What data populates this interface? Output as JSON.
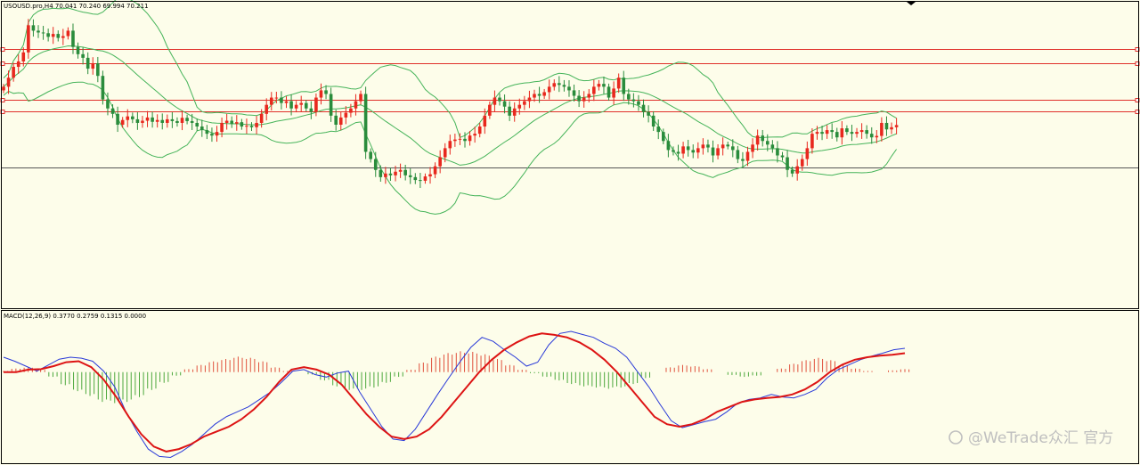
{
  "header": {
    "price_label": "USOUSD.pro,H4  70.041 70.240 69.994 70.211",
    "macd_label": "MACD(12,26,9) 0.3770 0.2759 0.1315 0.0000"
  },
  "watermark": "@WeTrade众汇 官方",
  "colors": {
    "background": "#fdfdea",
    "bull_candle": "#e8281e",
    "bear_candle": "#2a8c3c",
    "bollinger": "#46b45a",
    "level_line": "#e0302a",
    "current_price_line": "#555555",
    "macd_line": "#2a3ad8",
    "signal_line": "#dd1414",
    "hist_positive": "#e0503c",
    "hist_negative": "#4ca83c"
  },
  "chart_data": [
    {
      "type": "candlestick",
      "symbol": "USOUSD.pro",
      "timeframe": "H4",
      "last_bar": {
        "open": 70.041,
        "high": 70.24,
        "low": 69.994,
        "close": 70.211
      },
      "ylim": [
        66.2,
        74.6
      ],
      "closes": [
        72.3,
        72.55,
        72.85,
        73.0,
        73.25,
        74.0,
        73.85,
        73.8,
        73.78,
        73.68,
        73.76,
        73.65,
        73.7,
        73.85,
        73.4,
        73.2,
        73.1,
        72.8,
        72.95,
        72.6,
        71.95,
        71.7,
        71.55,
        71.25,
        71.38,
        71.48,
        71.4,
        71.3,
        71.36,
        71.45,
        71.33,
        71.38,
        71.3,
        71.4,
        71.35,
        71.3,
        71.44,
        71.35,
        71.3,
        71.2,
        71.1,
        71.0,
        70.95,
        71.05,
        71.3,
        71.36,
        71.28,
        71.32,
        71.2,
        71.22,
        71.18,
        71.3,
        71.55,
        71.8,
        72.0,
        72.0,
        71.85,
        71.9,
        71.7,
        71.8,
        71.85,
        71.7,
        71.6,
        72.0,
        72.2,
        72.1,
        71.5,
        71.25,
        71.45,
        71.58,
        71.7,
        71.9,
        72.1,
        70.5,
        70.3,
        70.0,
        69.8,
        69.9,
        69.85,
        69.95,
        70.0,
        69.85,
        69.8,
        69.72,
        69.7,
        69.82,
        69.88,
        70.1,
        70.35,
        70.6,
        70.8,
        70.84,
        70.86,
        70.8,
        70.95,
        71.0,
        71.2,
        71.5,
        71.8,
        72.0,
        71.9,
        71.75,
        71.5,
        71.7,
        71.8,
        71.9,
        72.0,
        72.1,
        72.05,
        72.15,
        72.3,
        72.4,
        72.35,
        72.3,
        72.2,
        72.05,
        71.9,
        72.0,
        72.1,
        72.3,
        72.38,
        72.3,
        72.0,
        72.25,
        72.55,
        72.1,
        71.95,
        71.9,
        71.8,
        71.6,
        71.5,
        71.2,
        71.05,
        70.8,
        70.55,
        70.5,
        70.45,
        70.65,
        70.55,
        70.48,
        70.6,
        70.7,
        70.62,
        70.4,
        70.6,
        70.7,
        70.65,
        70.55,
        70.3,
        70.25,
        70.5,
        70.7,
        70.95,
        70.8,
        70.7,
        70.6,
        70.4,
        70.35,
        70.0,
        69.9,
        70.1,
        70.3,
        70.6,
        71.0,
        71.05,
        71.0,
        71.1,
        71.05,
        70.9,
        71.15,
        71.05,
        71.0,
        71.05,
        71.1,
        71.0,
        70.9,
        70.94,
        71.3,
        71.12,
        71.18,
        71.24
      ]
    },
    {
      "type": "line",
      "indicator": "MACD(12,26,9)",
      "series": [
        {
          "name": "MACD",
          "values": [
            0.3,
            0.22,
            0.12,
            0.02,
            0.14,
            0.26,
            0.3,
            0.28,
            0.22,
            0.02,
            -0.3,
            -0.8,
            -1.2,
            -1.55,
            -1.7,
            -1.72,
            -1.6,
            -1.45,
            -1.25,
            -1.05,
            -0.9,
            -0.8,
            -0.7,
            -0.55,
            -0.4,
            -0.2,
            0.02,
            0.05,
            -0.05,
            -0.1,
            -0.02,
            0.02,
            -0.4,
            -0.75,
            -1.1,
            -1.35,
            -1.38,
            -1.15,
            -0.8,
            -0.45,
            -0.12,
            0.2,
            0.5,
            0.7,
            0.62,
            0.45,
            0.3,
            0.12,
            0.2,
            0.55,
            0.78,
            0.82,
            0.76,
            0.7,
            0.58,
            0.48,
            0.3,
            0.0,
            -0.3,
            -0.65,
            -0.98,
            -1.12,
            -1.06,
            -1.0,
            -0.95,
            -0.8,
            -0.62,
            -0.55,
            -0.52,
            -0.45,
            -0.5,
            -0.52,
            -0.45,
            -0.35,
            -0.12,
            0.05,
            0.15,
            0.25,
            0.32,
            0.38,
            0.45,
            0.48
          ]
        },
        {
          "name": "Signal",
          "values": [
            0.0,
            0.0,
            0.05,
            0.06,
            0.12,
            0.2,
            0.22,
            0.1,
            -0.15,
            -0.5,
            -0.9,
            -1.25,
            -1.5,
            -1.6,
            -1.55,
            -1.45,
            -1.3,
            -1.2,
            -1.1,
            -0.95,
            -0.75,
            -0.5,
            -0.2,
            0.05,
            0.1,
            0.05,
            -0.05,
            -0.25,
            -0.55,
            -0.85,
            -1.1,
            -1.3,
            -1.35,
            -1.3,
            -1.15,
            -0.9,
            -0.6,
            -0.3,
            0.0,
            0.25,
            0.45,
            0.6,
            0.72,
            0.78,
            0.75,
            0.7,
            0.6,
            0.45,
            0.25,
            0.0,
            -0.3,
            -0.6,
            -0.9,
            -1.05,
            -1.1,
            -1.05,
            -0.95,
            -0.8,
            -0.7,
            -0.6,
            -0.55,
            -0.52,
            -0.5,
            -0.45,
            -0.35,
            -0.2,
            0.0,
            0.15,
            0.25,
            0.3,
            0.33,
            0.35,
            0.38
          ]
        },
        {
          "name": "Histogram",
          "values": [
            0.02,
            0.06,
            0.08,
            0.04,
            -0.08,
            -0.22,
            -0.32,
            -0.4,
            -0.5,
            -0.52,
            -0.5,
            -0.42,
            -0.3,
            -0.18,
            -0.06,
            0.05,
            0.12,
            0.18,
            0.22,
            0.26,
            0.24,
            0.18,
            0.08,
            0.02,
            0.0,
            -0.04,
            -0.14,
            -0.24,
            -0.3,
            -0.3,
            -0.26,
            -0.18,
            -0.08,
            0.04,
            0.16,
            0.26,
            0.32,
            0.35,
            0.34,
            0.3,
            0.22,
            0.12,
            0.04,
            -0.02,
            -0.08,
            -0.14,
            -0.2,
            -0.24,
            -0.26,
            -0.28,
            -0.26,
            -0.2,
            -0.1,
            0.0,
            0.08,
            0.12,
            0.1,
            0.05,
            0.0,
            -0.05,
            -0.08,
            -0.06,
            0.0,
            0.06,
            0.14,
            0.2,
            0.24,
            0.2,
            0.12,
            0.06,
            0.02,
            0.0,
            0.03,
            0.05
          ]
        }
      ]
    }
  ]
}
